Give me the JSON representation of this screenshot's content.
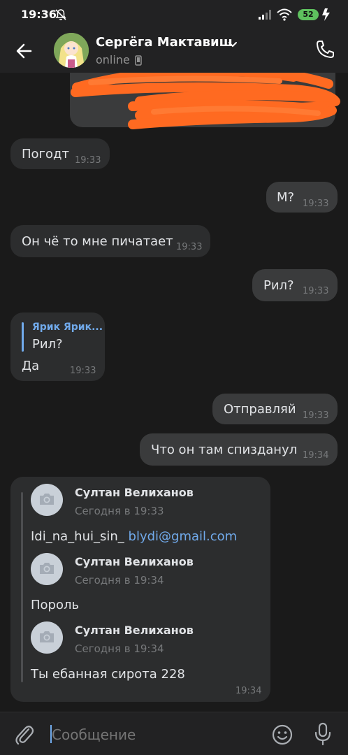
{
  "status_bar": {
    "time": "19:36",
    "battery": "52"
  },
  "header": {
    "name": "Сергёга Мактавиш",
    "status": "online"
  },
  "messages": [
    {
      "text": "Погодт",
      "time": "19:33"
    },
    {
      "text": "М?",
      "time": "19:33"
    },
    {
      "text": "Он чё то мне пичатает",
      "time": "19:33"
    },
    {
      "text": "Рил?",
      "time": "19:33"
    },
    {
      "reply_author": "Ярик Ярик...",
      "reply_text": "Рил?",
      "text": "Да",
      "time": "19:33"
    },
    {
      "text": "Отправляй",
      "time": "19:33"
    },
    {
      "text": "Что он там спизданул",
      "time": "19:34"
    }
  ],
  "forwarded": {
    "time": "19:34",
    "items": [
      {
        "author": "Султан Велиханов",
        "date": "Сегодня в 19:33",
        "text": "Idi_na_hui_sin_",
        "link": "blydi@gmail.com"
      },
      {
        "author": "Султан Велиханов",
        "date": "Сегодня в 19:34",
        "text": "Пороль"
      },
      {
        "author": "Султан Велиханов",
        "date": "Сегодня в 19:34",
        "text": "Ты ебанная сирота 228"
      }
    ]
  },
  "composer": {
    "placeholder": "Сообщение"
  },
  "colors": {
    "accent": "#71aaeb",
    "background": "#1a1a1a",
    "bubble_in": "#2c2d2e",
    "bubble_out": "#3a3b3c",
    "scribble": "#ff6a21"
  },
  "icons": [
    "mute-icon",
    "signal-icon",
    "wifi-icon",
    "charging-icon",
    "back-arrow-icon",
    "chevron-down-icon",
    "mobile-icon",
    "phone-icon",
    "camera-icon",
    "paperclip-icon",
    "emoji-icon",
    "microphone-icon"
  ]
}
